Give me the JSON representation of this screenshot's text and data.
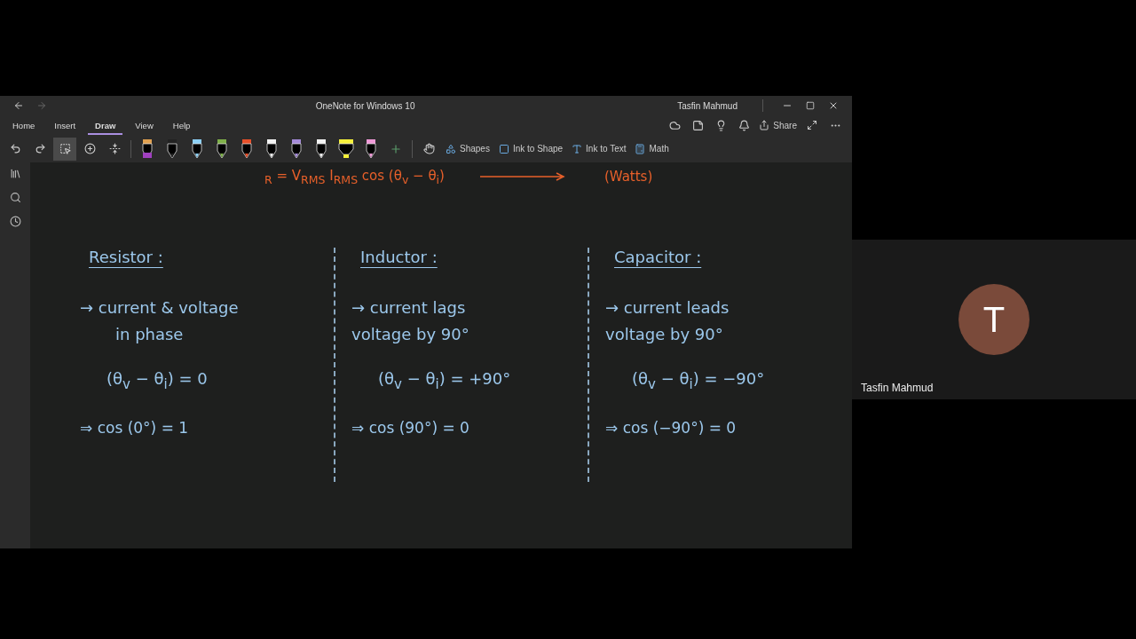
{
  "window": {
    "title": "OneNote for Windows 10",
    "user": "Tasfin Mahmud"
  },
  "ribbon_tabs": [
    {
      "label": "Home",
      "selected": false
    },
    {
      "label": "Insert",
      "selected": false
    },
    {
      "label": "Draw",
      "selected": true
    },
    {
      "label": "View",
      "selected": false
    },
    {
      "label": "Help",
      "selected": false
    }
  ],
  "header_actions": {
    "share": "Share"
  },
  "tools": [
    {
      "kind": "undo",
      "selected": false
    },
    {
      "kind": "redo",
      "selected": false
    },
    {
      "kind": "lasso",
      "selected": true
    },
    {
      "kind": "add-space",
      "selected": false
    },
    {
      "kind": "eraser-space",
      "selected": false
    }
  ],
  "pens": [
    {
      "kind": "eraser",
      "color": "#e0a050"
    },
    {
      "kind": "pen",
      "color": "#222222"
    },
    {
      "kind": "pen",
      "color": "#8ccff5"
    },
    {
      "kind": "pen",
      "color": "#7fb04a"
    },
    {
      "kind": "pen",
      "color": "#e8502a"
    },
    {
      "kind": "pen",
      "color": "#f2f2f2"
    },
    {
      "kind": "pen",
      "color": "#a48ad8"
    },
    {
      "kind": "pen",
      "color": "#f2f2f2"
    },
    {
      "kind": "highlighter",
      "color": "#f5f03a"
    },
    {
      "kind": "pen",
      "color": "#f09ad8"
    }
  ],
  "ink_actions": [
    {
      "kind": "shapes",
      "label": "Shapes"
    },
    {
      "kind": "ink-shape",
      "label": "Ink to Shape"
    },
    {
      "kind": "ink-text",
      "label": "Ink to Text"
    },
    {
      "kind": "math",
      "label": "Math"
    }
  ],
  "top_formula": {
    "left": "$_{R}$  =  V$_{RMS}$ I$_{RMS}$  cos (θ$_{v}$ − θ$_{i}$)",
    "right": "(Watts)"
  },
  "columns": [
    {
      "title": "Resistor :",
      "lines": [
        "→ current & voltage",
        "in phase"
      ],
      "equation": "(θ$_{v}$ − θ$_{i}$) = 0",
      "result": "⇒ cos (0°) = 1"
    },
    {
      "title": "Inductor :",
      "lines": [
        "→ current  lags",
        "voltage by 90°"
      ],
      "equation": "(θ$_{v}$ − θ$_{i}$) = +90°",
      "result": "⇒ cos (90°) = 0"
    },
    {
      "title": "Capacitor :",
      "lines": [
        "→ current   leads",
        "voltage  by  90°"
      ],
      "equation": "(θ$_{v}$ − θ$_{i}$) = −90°",
      "result": "⇒ cos (−90°) = 0"
    }
  ],
  "participant": {
    "initial": "T",
    "name": "Tasfin Mahmud"
  }
}
